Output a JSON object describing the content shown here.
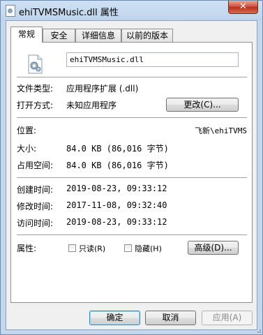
{
  "window": {
    "title": "ehiTVMSMusic.dll 属性",
    "close_glyph": "✕"
  },
  "tabs": [
    {
      "label": "常规",
      "active": true
    },
    {
      "label": "安全",
      "active": false
    },
    {
      "label": "详细信息",
      "active": false
    },
    {
      "label": "以前的版本",
      "active": false
    }
  ],
  "general": {
    "file_name": "ehiTVMSMusic.dll",
    "file_type_label": "文件类型:",
    "file_type_value": "应用程序扩展 (.dll)",
    "open_with_label": "打开方式:",
    "open_with_value": "未知应用程序",
    "change_button": "更改(C)...",
    "location_label": "位置:",
    "location_value": "飞新\\ehiTVMS",
    "size_label": "大小:",
    "size_value": "84.0 KB (86,016 字节)",
    "size_on_disk_label": "占用空间:",
    "size_on_disk_value": "84.0 KB (86,016 字节)",
    "created_label": "创建时间:",
    "created_value": "2019-08-23, 09:33:12",
    "modified_label": "修改时间:",
    "modified_value": "2017-11-08, 09:32:40",
    "accessed_label": "访问时间:",
    "accessed_value": "2019-08-23, 09:33:12",
    "attributes_label": "属性:",
    "readonly_label": "只读(R)",
    "readonly_checked": false,
    "hidden_label": "隐藏(H)",
    "hidden_checked": false,
    "advanced_button": "高级(D)..."
  },
  "footer": {
    "ok": "确定",
    "cancel": "取消",
    "apply": "应用(A)"
  },
  "icons": {
    "file": "dll-file-icon",
    "title": "dll-file-icon"
  }
}
